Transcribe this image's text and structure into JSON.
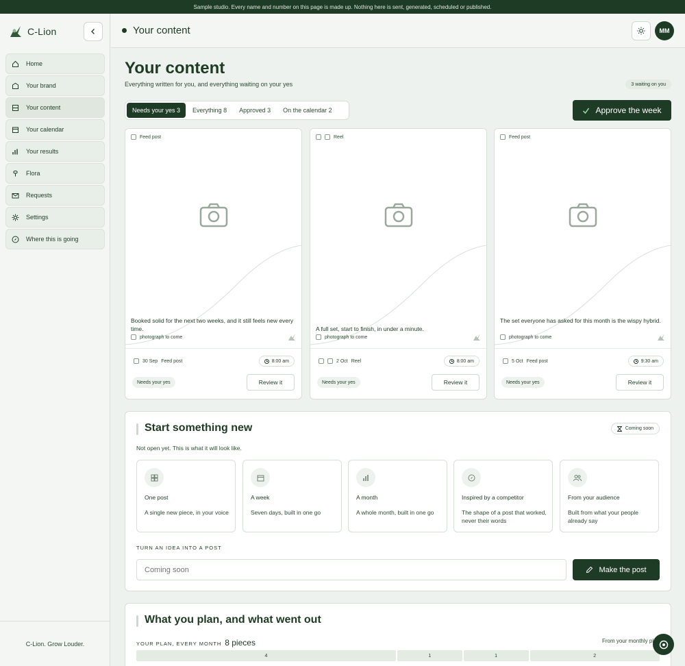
{
  "banner": {
    "text": "Sample studio. Every name and number on this page is made up. Nothing here is sent, generated, scheduled or published."
  },
  "brand": {
    "name": "C-Lion"
  },
  "sidebar": {
    "items": [
      {
        "label": "Home",
        "icon": "home-icon"
      },
      {
        "label": "Your brand",
        "icon": "brand-icon"
      },
      {
        "label": "Your content",
        "icon": "content-icon"
      },
      {
        "label": "Your calendar",
        "icon": "calendar-icon"
      },
      {
        "label": "Your results",
        "icon": "results-icon"
      },
      {
        "label": "Flora",
        "icon": "flora-icon"
      },
      {
        "label": "Requests",
        "icon": "mail-icon"
      },
      {
        "label": "Settings",
        "icon": "settings-icon"
      },
      {
        "label": "Where this is going",
        "icon": "compass-icon"
      }
    ],
    "footer": "C-Lion. Grow Louder."
  },
  "topbar": {
    "title": "Your content",
    "avatar": "MM"
  },
  "page": {
    "title": "Your content",
    "subtitle": "Everything written for you, and everything waiting on your yes",
    "waiting": "3 waiting on you",
    "tabs": [
      "Needs your yes 3",
      "Everything 8",
      "Approved 3",
      "On the calendar 2"
    ],
    "approve_label": "Approve the week"
  },
  "cards": [
    {
      "type": "Feed post",
      "caption": "Booked solid for the next two weeks, and it still feels new every time.",
      "photo": "photograph to come",
      "date": "30 Sep",
      "format": "Feed post",
      "time": "8:00 am",
      "status": "Needs your yes",
      "action": "Review it"
    },
    {
      "type": "Reel",
      "caption": "A full set, start to finish, in under a minute.",
      "photo": "photograph to come",
      "date": "2 Oct",
      "format": "Reel",
      "time": "8:00 am",
      "status": "Needs your yes",
      "action": "Review it"
    },
    {
      "type": "Feed post",
      "caption": "The set everyone has asked for this month is the wispy hybrid.",
      "photo": "photograph to come",
      "date": "5 Oct",
      "format": "Feed post",
      "time": "9:30 am",
      "status": "Needs your yes",
      "action": "Review it"
    }
  ],
  "start": {
    "title": "Start something new",
    "badge": "Coming soon",
    "note": "Not open yet. This is what it will look like.",
    "options": [
      {
        "title": "One post",
        "desc": "A single new piece, in your voice"
      },
      {
        "title": "A week",
        "desc": "Seven days, built in one go"
      },
      {
        "title": "A month",
        "desc": "A whole month, built in one go"
      },
      {
        "title": "Inspired by a competitor",
        "desc": "The shape of a post that worked, never their words"
      },
      {
        "title": "From your audience",
        "desc": "Built from what your people already say"
      }
    ],
    "idea_label": "TURN AN IDEA INTO A POST",
    "idea_placeholder": "Coming soon",
    "make_label": "Make the post"
  },
  "plan": {
    "title": "What you plan, and what went out",
    "label": "YOUR PLAN, EVERY MONTH",
    "count": "8 pieces",
    "right": "From your monthly plan",
    "segments": [
      {
        "value": "4",
        "share": 4
      },
      {
        "value": "1",
        "share": 1
      },
      {
        "value": "1",
        "share": 1
      },
      {
        "value": "2",
        "share": 2
      }
    ]
  },
  "colors": {
    "primary": "#1e3b26",
    "background": "#eef2ee",
    "card": "#ffffff",
    "border": "#d7dfd7"
  }
}
